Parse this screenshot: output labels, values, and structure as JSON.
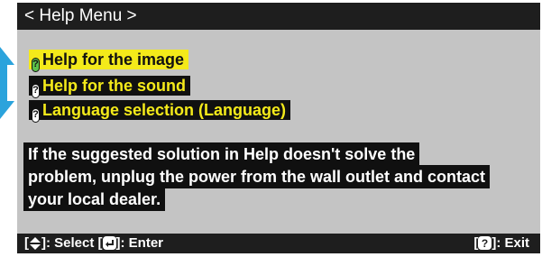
{
  "title": "< Help Menu >",
  "menu": [
    {
      "label": "Help for the image",
      "selected": true
    },
    {
      "label": "Help for the sound",
      "selected": false
    },
    {
      "label": "Language selection (Language)",
      "selected": false
    }
  ],
  "help_lines": [
    "If the suggested solution in Help doesn't solve the",
    "problem, unplug the power from the wall outlet and contact",
    "your local dealer."
  ],
  "footer": {
    "select_label": "]: Select [",
    "enter_label": "]: Enter",
    "exit_label": "]: Exit",
    "bracket_open": "["
  },
  "colors": {
    "window_bg": "#c4c4c4",
    "bar_bg": "#1e1e1e",
    "highlight": "#f4ea1a",
    "nav_arrow": "#2ba3dc"
  },
  "icons": {
    "nav": "updown-nav-arrow-icon",
    "help": "help-question-icon",
    "select": "updown-key-icon",
    "enter": "enter-key-icon",
    "exit": "question-key-icon"
  }
}
